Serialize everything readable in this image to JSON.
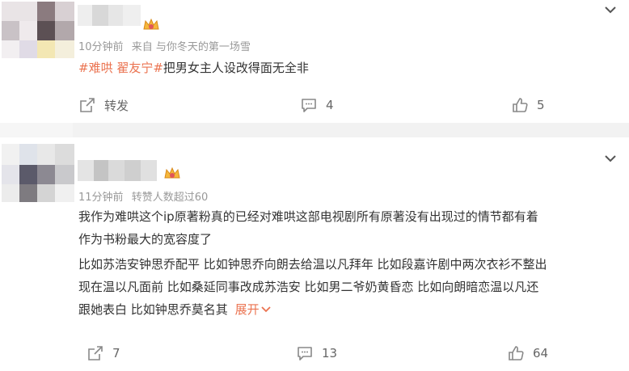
{
  "post1": {
    "meta_time": "10分钟前",
    "meta_source": "来自 与你冬天的第一场雪",
    "tag_prefix": "#难哄 ",
    "tag_name": "翟友宁#",
    "body_text": "把男女主人设改得面无全非",
    "repost_label": "转发",
    "comment_count": "4",
    "like_count": "5"
  },
  "post2": {
    "meta_time": "11分钟前",
    "meta_extra": "转赞人数超过60",
    "line1": "我作为难哄这个ip原著粉真的已经对难哄这部电视剧所有原著没有出现过的情节都有着",
    "line2": "作为书粉最大的宽容度了",
    "line3": "比如苏浩安钟思乔配平 比如钟思乔向朗去给温以凡拜年 比如段嘉许剧中两次衣衫不整出",
    "line4": "现在温以凡面前 比如桑延同事改成苏浩安 比如男二爷奶黄昏恋 比如向朗暗恋温以凡还",
    "line5": "跟她表白 比如钟思乔莫名其",
    "expand_label": "展开",
    "repost_count": "7",
    "comment_count": "13",
    "like_count": "64"
  },
  "colors": {
    "accent": "#eb7350",
    "meta": "#999999",
    "separator": "#f2f2f2"
  },
  "icons": [
    "crown-badge-icon",
    "chevron-down-icon",
    "repost-icon",
    "comment-icon",
    "like-icon"
  ]
}
